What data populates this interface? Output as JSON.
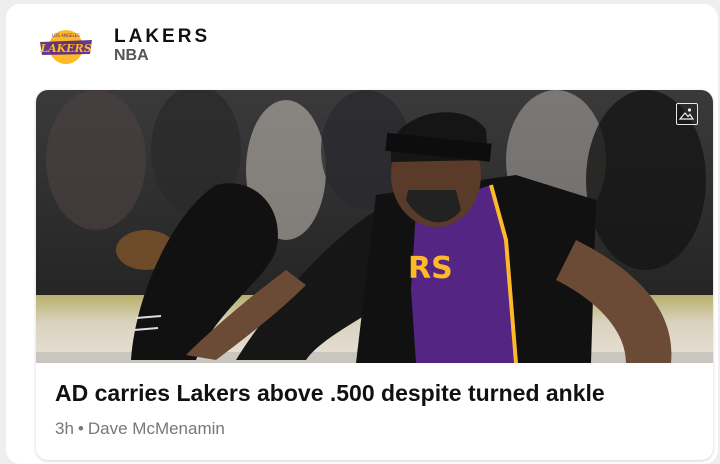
{
  "header": {
    "team_name": "LAKERS",
    "league": "NBA",
    "logo_icon": "lakers-logo"
  },
  "article": {
    "headline": "AD carries Lakers above .500 despite turned ankle",
    "time": "3h",
    "separator": "•",
    "author": "Dave McMenamin",
    "image_badge_icon": "image-icon"
  },
  "colors": {
    "lakers_purple": "#552583",
    "lakers_gold": "#FDB927"
  }
}
